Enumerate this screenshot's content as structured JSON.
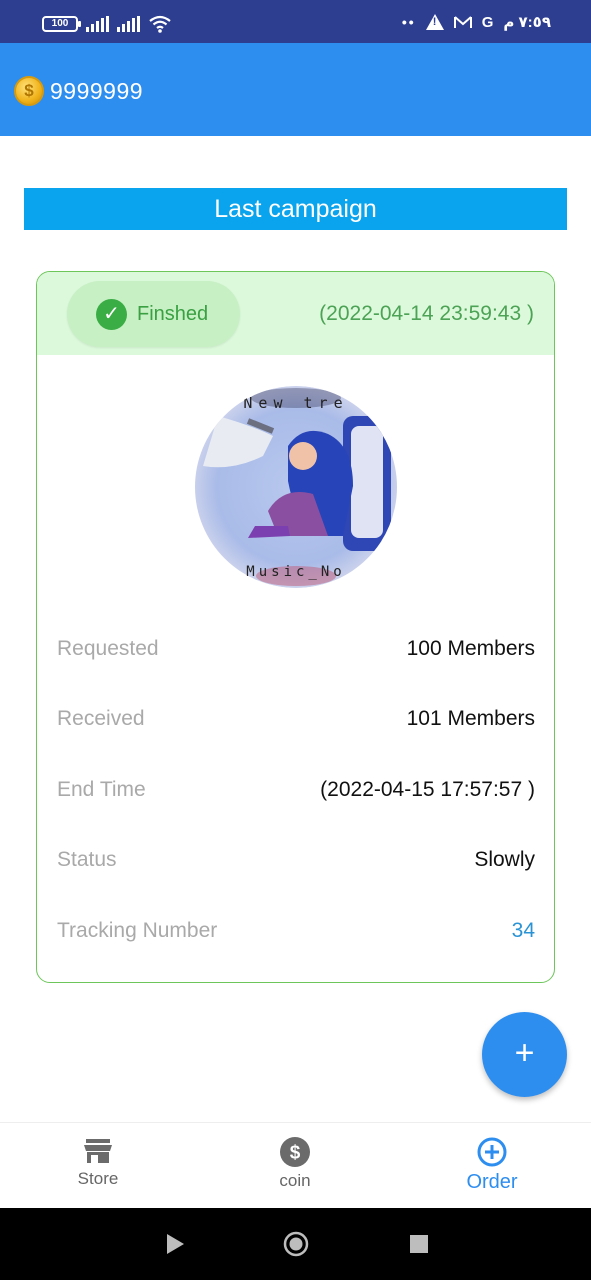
{
  "status_bar": {
    "battery": "100",
    "time": "٧:٥٩ م",
    "dots": "••",
    "google": "G"
  },
  "header": {
    "coin_symbol": "$",
    "coin_amount": "9999999"
  },
  "section": {
    "title": "Last campaign"
  },
  "campaign": {
    "status_label": "Finshed",
    "check_mark": "✓",
    "created": "(2022-04-14 23:59:43 )",
    "rows": [
      {
        "label": "Requested",
        "value": "100 Members"
      },
      {
        "label": "Received",
        "value": "101 Members"
      },
      {
        "label": "End Time",
        "value": "(2022-04-15 17:57:57 )"
      },
      {
        "label": "Status",
        "value": "Slowly"
      },
      {
        "label": "Tracking Number",
        "value": "34"
      }
    ],
    "avatar_text_top": "New tre",
    "avatar_text_bottom": "Music_No"
  },
  "fab": {
    "symbol": "+"
  },
  "bottom_nav": {
    "items": [
      {
        "label": "Store",
        "icon": "store-icon"
      },
      {
        "label": "coin",
        "icon": "dollar-icon"
      },
      {
        "label": "Order",
        "icon": "add-circle-icon"
      }
    ],
    "active": "Order"
  },
  "colors": {
    "status_bar": "#2d3e91",
    "app_bar": "#2e8ef0",
    "section_title": "#0aa4ee",
    "card_border": "#6cc65a",
    "card_head": "#dcfadb",
    "success": "#3bad45",
    "link": "#2a93d5"
  }
}
